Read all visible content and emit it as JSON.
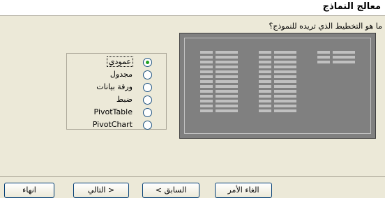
{
  "window": {
    "title": "معالج النماذج"
  },
  "question": "ما هو التخطيط الذي تريده للنموذج؟",
  "layout_options": [
    {
      "label": "عمودي",
      "selected": true
    },
    {
      "label": "مجدول",
      "selected": false
    },
    {
      "label": "ورقة بيانات",
      "selected": false
    },
    {
      "label": "ضبط",
      "selected": false
    },
    {
      "label": "PivotTable",
      "selected": false
    },
    {
      "label": "PivotChart",
      "selected": false
    }
  ],
  "buttons": {
    "cancel": "الغاء الأمر",
    "back": "< السابق",
    "next": "التالي >",
    "finish": "انهاء"
  },
  "colors": {
    "accent": "#21a121",
    "preview_bg": "#808080"
  }
}
